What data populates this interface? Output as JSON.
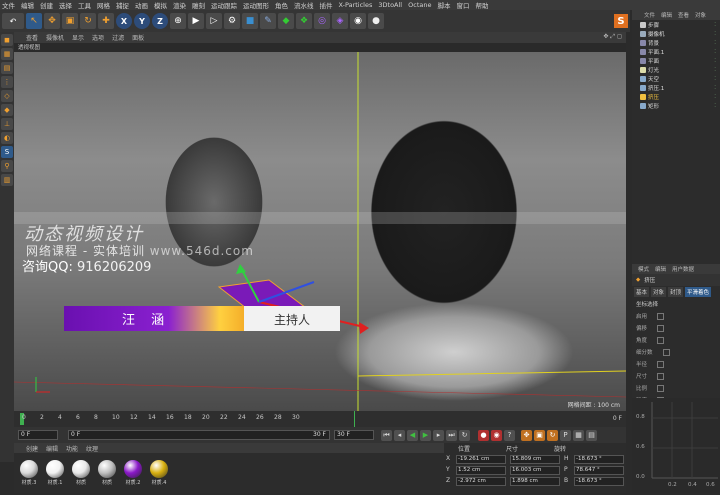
{
  "menubar": [
    "文件",
    "编辑",
    "创建",
    "选择",
    "工具",
    "网格",
    "捕捉",
    "动画",
    "模拟",
    "渲染",
    "雕刻",
    "运动跟踪",
    "运动图形",
    "角色",
    "流水线",
    "插件",
    "X-Particles",
    "3DtoAll",
    "Octane",
    "脚本",
    "窗口",
    "帮助"
  ],
  "toolbar": {
    "undo": "↶",
    "axis_x": "X",
    "axis_y": "Y",
    "axis_z": "Z"
  },
  "logo": "S",
  "viewport": {
    "menu": [
      "查看",
      "摄像机",
      "显示",
      "选项",
      "过滤",
      "面板"
    ],
    "corner_icons": "✥ ⤢ ◻",
    "label": "透视视图",
    "grid_spacing": "网格间距 : 100 cm",
    "watermark_title": "动态视频设计",
    "watermark_subtitle": "网络课程 - 实体培训",
    "watermark_url": "www.546d.com",
    "watermark_qq_label": "咨询QQ:",
    "watermark_qq": "916206209",
    "name_text": "汪 涵",
    "white_bar_text": "主持人"
  },
  "timeline": {
    "ticks": [
      "0",
      "2",
      "4",
      "6",
      "8",
      "10",
      "12",
      "14",
      "16",
      "18",
      "20",
      "22",
      "24",
      "26",
      "28",
      "30"
    ],
    "end_frame": "0 F",
    "current_frame": "0 F",
    "range_start": "0 F",
    "range_end": "30 F",
    "max_frame": "30 F"
  },
  "materials": {
    "menu": [
      "创建",
      "编辑",
      "功能",
      "纹理"
    ],
    "items": [
      {
        "label": "材质.3",
        "color": "#d9d9d9"
      },
      {
        "label": "材质.1",
        "color": "#f2f2f2"
      },
      {
        "label": "材质",
        "color": "#e8e8e8"
      },
      {
        "label": "材质",
        "color": "#c0c0c0"
      },
      {
        "label": "材质.2",
        "color": "#8a18c8"
      },
      {
        "label": "材质.4",
        "color": "#d8b010"
      }
    ]
  },
  "coords": {
    "headers": [
      "位置",
      "尺寸",
      "旋转"
    ],
    "rows": [
      {
        "axis": "X",
        "pos": "-19.261 cm",
        "size": "15.809 cm",
        "rot_axis": "H",
        "rot": "-18.673 °"
      },
      {
        "axis": "Y",
        "pos": "1.52 cm",
        "size": "16.003 cm",
        "rot_axis": "P",
        "rot": "78.647 °"
      },
      {
        "axis": "Z",
        "pos": "-2.972 cm",
        "size": "1.898 cm",
        "rot_axis": "B",
        "rot": "-18.673 °"
      }
    ]
  },
  "objects": {
    "menu": [
      "文件",
      "编辑",
      "查看",
      "对象"
    ],
    "items": [
      {
        "label": "步骤",
        "color": "#c8c8c8"
      },
      {
        "label": "摄像机",
        "color": "#9ab"
      },
      {
        "label": "背景",
        "color": "#88a"
      },
      {
        "label": "平面.1",
        "color": "#88a"
      },
      {
        "label": "平面",
        "color": "#88a"
      },
      {
        "label": "灯光",
        "color": "#dda"
      },
      {
        "label": "天空",
        "color": "#8ac"
      },
      {
        "label": "挤压.1",
        "color": "#8ac"
      },
      {
        "label": "挤压",
        "color": "#f0c040",
        "highlight": true
      },
      {
        "label": "矩形",
        "color": "#8ac"
      }
    ]
  },
  "attributes": {
    "menu": [
      "模式",
      "编辑",
      "用户数据"
    ],
    "object_name": "挤压",
    "tabs": [
      "基本",
      "对象",
      "封顶",
      "平滑着色"
    ],
    "active_tab": "平滑着色",
    "section": "坐标选择",
    "rows": [
      "启用",
      "偏移",
      "角度",
      "细分数",
      "半径",
      "尺寸",
      "比例",
      "强度"
    ]
  },
  "graph": {
    "labels": [
      "0.8",
      "0.6",
      "0.4",
      "0.2",
      "0.0",
      "0.2",
      "0.4",
      "0.6"
    ]
  }
}
